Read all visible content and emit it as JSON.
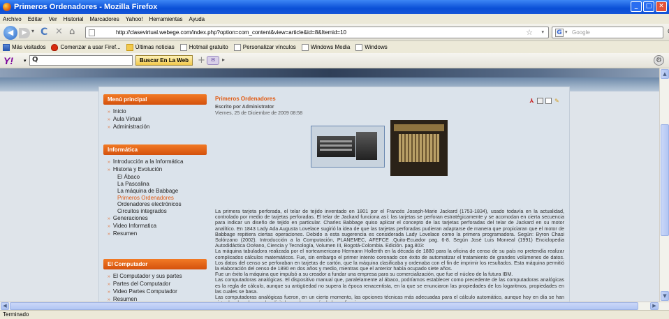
{
  "window": {
    "title": "Primeros Ordenadores - Mozilla Firefox"
  },
  "menubar": [
    "Archivo",
    "Editar",
    "Ver",
    "Historial",
    "Marcadores",
    "Yahoo!",
    "Herramientas",
    "Ayuda"
  ],
  "nav": {
    "url": "http://clasevirtual.webege.com/index.php?option=com_content&view=article&id=8&Itemid=10",
    "search_placeholder": "Google"
  },
  "bookmarks": [
    {
      "label": "Más visitados",
      "icon": "chart"
    },
    {
      "label": "Comenzar a usar Firef...",
      "icon": "flame"
    },
    {
      "label": "Últimas noticias",
      "icon": "folder"
    },
    {
      "label": "Hotmail gratuito",
      "icon": "page"
    },
    {
      "label": "Personalizar vínculos",
      "icon": "page"
    },
    {
      "label": "Windows Media",
      "icon": "page"
    },
    {
      "label": "Windows",
      "icon": "page"
    }
  ],
  "yahoo": {
    "logo": "Y!",
    "search_button": "Buscar En La Web"
  },
  "sidebar": {
    "menu_principal": {
      "title": "Menú principal",
      "items": [
        "Inicio",
        "Aula Virtual",
        "Administración"
      ]
    },
    "informatica": {
      "title": "Informática",
      "items": [
        {
          "label": "Introducción a la Informática",
          "sub": false,
          "active": false
        },
        {
          "label": "Historia y Evolución",
          "sub": false,
          "active": false
        },
        {
          "label": "El Ábaco",
          "sub": true,
          "active": false
        },
        {
          "label": "La Pascalina",
          "sub": true,
          "active": false
        },
        {
          "label": "La máquina de Babbage",
          "sub": true,
          "active": false
        },
        {
          "label": "Primeros Ordenadores",
          "sub": true,
          "active": true
        },
        {
          "label": "Ordenadores electrónicos",
          "sub": true,
          "active": false
        },
        {
          "label": "Circuitos integrados",
          "sub": true,
          "active": false
        },
        {
          "label": "Generaciones",
          "sub": false,
          "active": false
        },
        {
          "label": "Video Informatica",
          "sub": false,
          "active": false
        },
        {
          "label": "Resumen",
          "sub": false,
          "active": false
        }
      ]
    },
    "computador": {
      "title": "El Computador",
      "items": [
        "El Computador y sus partes",
        "Partes del Computador",
        "Video Partes Computador",
        "Resumen"
      ]
    }
  },
  "article": {
    "title": "Primeros Ordenadores",
    "author": "Escrito por Administrator",
    "date": "Viernes, 25 de Diciembre de 2009 08:58",
    "paragraphs": [
      "La primera tarjeta perforada, el telar de tejido inventado en 1801 por el Francés Joseph-Marie Jackard (1753-1834), usado todavía en la actualidad, controlado por medio de tarjetas perforadas. El telar de Jackard funciona así: las tarjetas se perforan estratégicamente y se acomodan en cierta secuencia para indicar un diseño de tejido en particular. Charles Babbage quiso aplicar el concepto de las tarjetas perforadas del telar de Jackard en su motor analítico. En 1843 Lady Ada Augusta Lovelace sugirió la idea de que las tarjetas perforadas pudieran adaptarse de manera que propiciaran que el motor de Babbage repitiera ciertas operaciones. Debido a esta sugerencia es considerada Lady Lovelace como la primera programadora. Según: Byron Chasi Solórzano (2002). Introducción a la Computación, PLANEMEC, AFEFCE .Quito-Ecuador pag. 6-8. Según José Luis Monreal (1991) Enciclopedia Autodidáctica Océano, Ciencia y Tecnología, Volumen III, Bogotá-Colombia. Edición. pag.803:",
      "La máquina tabuladora realizada por el norteamericano Hermann Hollerith en la década de 1880 para la oficina de censo de su país no pretendía realizar complicados cálculos matemáticos. Fue, sin embargo el primer intento coronado con éxito de automatizar el tratamiento de grandes volúmenes de datos. Los datos del censo se perforaban en tarjetas de cartón, que la máquina clasificaba y ordenaba con el fin de imprimir los resultados. Esta máquina permitió la elaboración del censo de 1890 en dos años y medio, mientras que el anterior había ocupado siete años.",
      "Fue un éxito la máquina que impulsó a su creador a fundar una empresa para su comercialización, que fue el núcleo de la futura IBM.",
      "Las computadoras analógicas. El dispositivo manual que, paralelamente al ábaco, podríamos establecer como precedente de las computadoras analógicas es la regla de cálculo, aunque su antigüedad no supera la época renacentista, en la que se enunciaron las propiedades de los logaritmos, propiedades en las cuales se basa.",
      "Las computadoras analógicas fueron, en un cierto momento, las opciones técnicas más adecuadas para el cálculo automático, aunque hoy en día se han visto desplazadas por las digitales en la mayoría de las aplicaciones."
    ]
  },
  "status": "Terminado"
}
